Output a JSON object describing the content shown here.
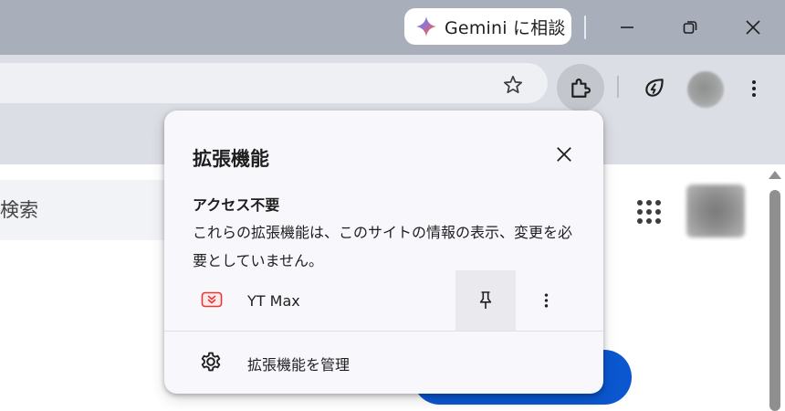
{
  "titlebar": {
    "gemini_label": "Gemini に相談",
    "icons": [
      "gemini-spark-icon",
      "minimize-icon",
      "restore-icon",
      "close-icon"
    ]
  },
  "toolbar": {
    "icons": [
      "bookmark-star-icon",
      "extensions-puzzle-icon",
      "performance-leaf-icon",
      "profile-avatar",
      "more-menu-icon"
    ]
  },
  "page": {
    "search_text": "検索",
    "icons": [
      "google-apps-grid-icon",
      "account-avatar"
    ]
  },
  "popup": {
    "title": "拡張機能",
    "section_title": "アクセス不要",
    "section_desc": "これらの拡張機能は、このサイトの情報の表示、変更を必要としていません。",
    "extensions": [
      {
        "name": "YT Max",
        "icon": "yt-max-icon"
      }
    ],
    "manage_label": "拡張機能を管理"
  },
  "colors": {
    "titlebar": "#a9aebb",
    "toolbar": "#dbdee4",
    "popup_bg": "#f8f7fb",
    "accent_blue": "#0b57d0",
    "yt_max_red": "#e53935"
  }
}
